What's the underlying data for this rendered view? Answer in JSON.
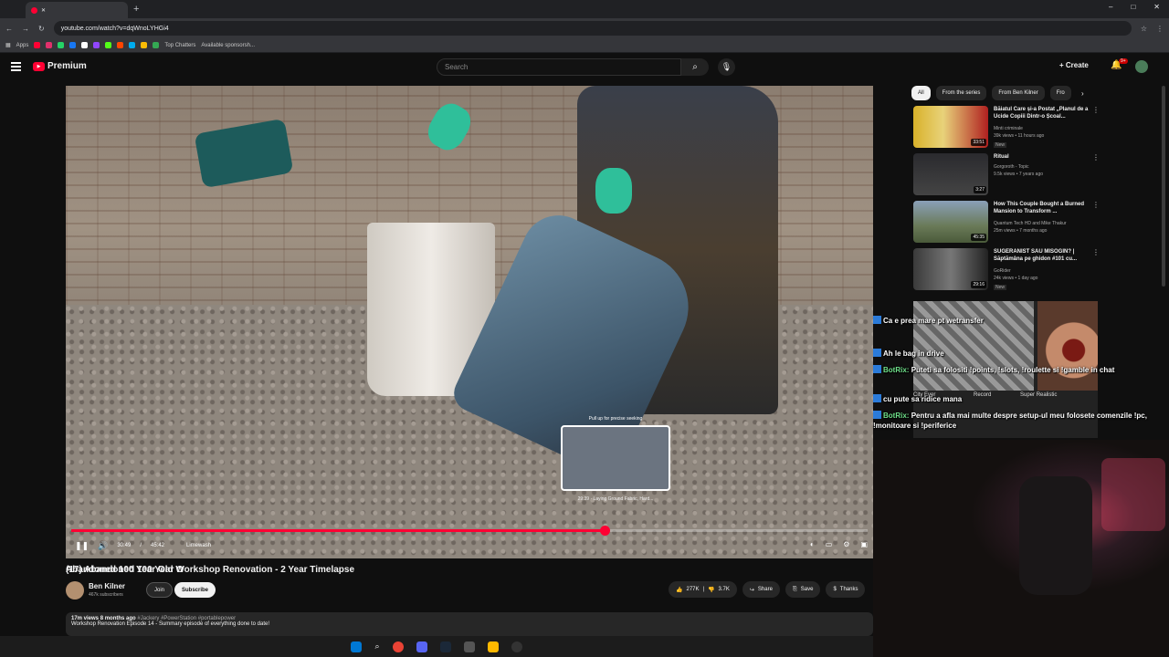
{
  "browser": {
    "tab_title": "(17) Abandoned 100 Year O",
    "new_tab": "+",
    "url": "youtube.com/watch?v=dqWnoLYHGi4",
    "window_controls": [
      "–",
      "□",
      "✕"
    ],
    "bookmarks": {
      "apps_label": "Apps",
      "items": [
        "Top Chatters",
        "Available sponsorsh..."
      ]
    }
  },
  "youtube": {
    "logo_text": "Premium",
    "search_placeholder": "Search",
    "create_label": "Create",
    "notification_count": "9+"
  },
  "player": {
    "seek_hint": "Pull up for precise seeking",
    "seek_chapter": "29:39 · Laying Ground Fabric, Hard...",
    "current_time": "30:49",
    "duration": "45:42",
    "chapter": "Limewash",
    "progress": 0.67
  },
  "video": {
    "title": "Abandoned 100 Year Old Workshop Renovation - 2 Year Timelapse",
    "channel_name": "Ben Kilner",
    "subscribers": "467k subscribers",
    "join_label": "Join",
    "subscribe_label": "Subscribe",
    "likes": "277K",
    "dislikes": "3.7K",
    "share_label": "Share",
    "save_label": "Save",
    "thanks_label": "Thanks",
    "views": "17m views",
    "age": "8 months ago",
    "hashtags": "#Jackery #PowerStation #portablepower",
    "description_line": "Workshop Renovation Episode 14 - Summary episode of everything done to date!"
  },
  "sidebar": {
    "chips": [
      "All",
      "From the series",
      "From Ben Kilner",
      "Fro"
    ],
    "recommendations": [
      {
        "title": "Băiatul Care și-a Postat „Planul de a Ucide Copiii Dintr-o Școal...",
        "channel": "Minti criminale",
        "meta": "39k views • 11 hours ago",
        "badge": "New",
        "duration": "33:51"
      },
      {
        "title": "Ritual",
        "channel": "Gorgoroth - Topic",
        "meta": "9.5k views • 7 years ago",
        "badge": "",
        "duration": "3:27"
      },
      {
        "title": "How This Couple Bought a Burned Mansion to Transform ...",
        "channel": "Quantum Tech HD and Mike Thakur",
        "meta": "25m views • 7 months ago",
        "badge": "",
        "duration": "45:35"
      },
      {
        "title": "SUGERANIST SAU MISOGIN? | Săptămâna pe ghidon #101 cu...",
        "channel": "GoRider",
        "meta": "24k views • 1 day ago",
        "badge": "New",
        "duration": "29:16"
      }
    ],
    "overlay_labels": [
      "City Ever",
      "Record",
      "Super Realistic"
    ]
  },
  "chat": [
    {
      "user": "",
      "text": "Ca e prea mare pt wetransfer"
    },
    {
      "user": "",
      "text": "Ah le bag in drive"
    },
    {
      "user": "BotRix:",
      "text": "Puteti sa folositi !points, !slots, !roulette si !gamble in chat"
    },
    {
      "user": "",
      "text": "cu pute sa ridice mana"
    },
    {
      "user": "BotRix:",
      "text": "Pentru a afla mai multe despre setup-ul meu folosete comenzile !pc, !monitoare si !periferice"
    }
  ],
  "colors": {
    "brand_red": "#ff0033",
    "background": "#0f0f0f",
    "chip_bg": "#272727"
  }
}
